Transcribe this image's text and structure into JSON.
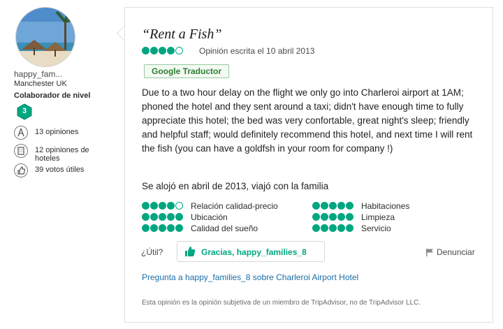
{
  "reviewer": {
    "username": "happy_fam...",
    "location": "Manchester UK",
    "level_label": "Colaborador de nivel",
    "level_number": "3",
    "stats": [
      {
        "icon": "pen-icon",
        "text": "13 opiniones"
      },
      {
        "icon": "hotel-icon",
        "text": "12 opiniones de hoteles"
      },
      {
        "icon": "thumbs-up-icon",
        "text": "39 votos útiles"
      }
    ]
  },
  "review": {
    "title": "“Rent a Fish”",
    "rating": 4,
    "date_text": "Opinión escrita el 10 abril 2013",
    "translate_label": "Google Traductor",
    "body": "Due to a two hour delay on the flight we only go into Charleroi airport at 1AM; phoned the hotel and they sent around a taxi; didn't have enough time to fully appreciate this hotel; the bed was very confortable, great night's sleep; friendly and helpful staff; would definitely recommend this hotel, and next time I will rent the fish (you can have a goldfsh in your room for company !)",
    "stay_text": "Se alojó en abril de 2013, viajó con la familia",
    "sub_ratings": [
      {
        "label": "Relación calidad-precio",
        "rating": 4
      },
      {
        "label": "Ubicación",
        "rating": 5
      },
      {
        "label": "Calidad del sueño",
        "rating": 5
      },
      {
        "label": "Habitaciones",
        "rating": 5
      },
      {
        "label": "Limpieza",
        "rating": 5
      },
      {
        "label": "Servicio",
        "rating": 5
      }
    ],
    "helpful_label": "¿Útil?",
    "thanks_label": "Gracias, happy_families_8",
    "report_label": "Denunciar",
    "ask_link": "Pregunta a happy_families_8 sobre Charleroi Airport Hotel",
    "disclaimer": "Esta opinión es la opinión subjetiva de un miembro de TripAdvisor, no de TripAdvisor LLC."
  },
  "colors": {
    "accent": "#00a680",
    "link": "#1a6ea8",
    "badge": "#00a680"
  }
}
